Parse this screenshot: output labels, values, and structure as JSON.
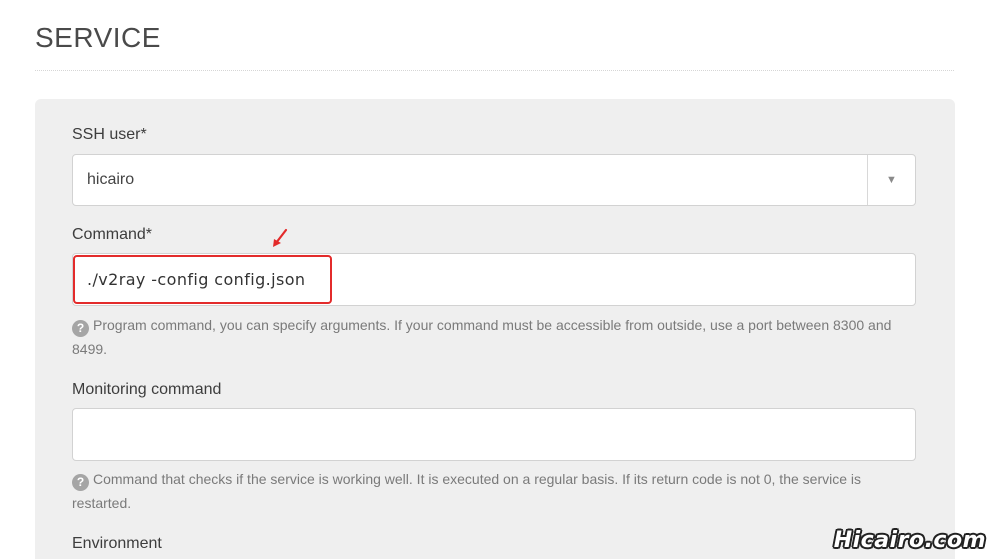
{
  "section": {
    "title": "SERVICE"
  },
  "ssh_user": {
    "label": "SSH user*",
    "value": "hicairo"
  },
  "command": {
    "label": "Command*",
    "value": "./v2ray -config config.json",
    "help": "Program command, you can specify arguments. If your command must be accessible from outside, use a port between 8300 and 8499."
  },
  "monitoring": {
    "label": "Monitoring command",
    "value": "",
    "help": "Command that checks if the service is working well. It is executed on a regular basis. If its return code is not 0, the service is restarted."
  },
  "environment": {
    "label": "Environment"
  },
  "annotation": {
    "highlight_color": "#e32b2b"
  },
  "watermark": {
    "text": "Hicairo.com"
  },
  "icons": {
    "help": "question-circle-icon",
    "dropdown": "caret-down-icon"
  }
}
